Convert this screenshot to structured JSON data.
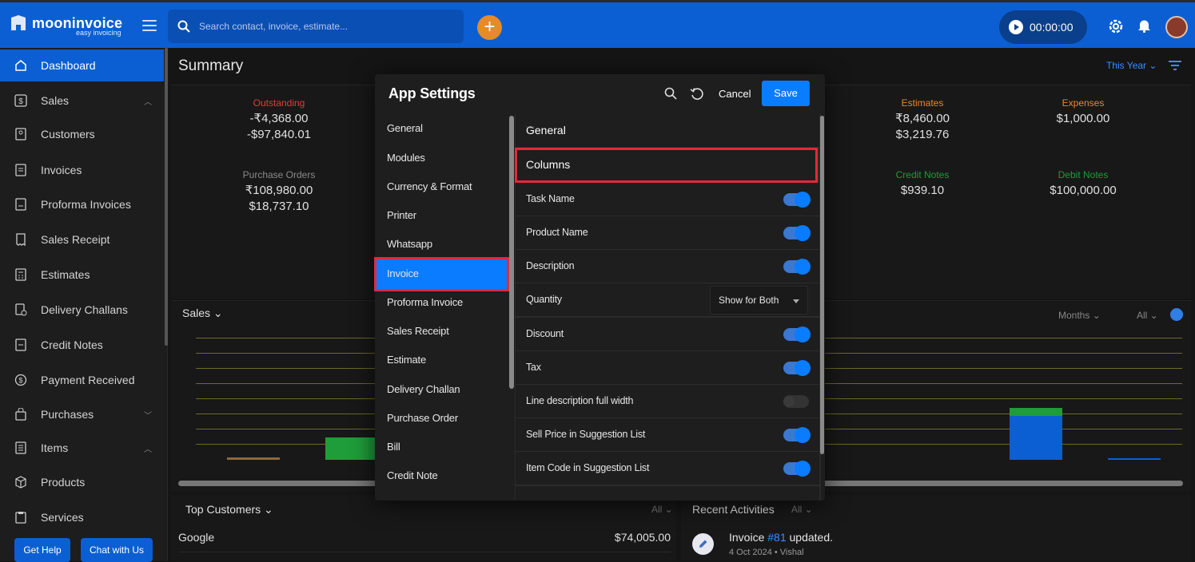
{
  "app": {
    "name": "mooninvoice",
    "tagline": "easy invoicing"
  },
  "search": {
    "placeholder": "Search contact, invoice, estimate..."
  },
  "timer": {
    "value": "00:00:00"
  },
  "sidebar": {
    "items": [
      {
        "label": "Dashboard",
        "icon": "home-icon",
        "active": true
      },
      {
        "label": "Sales",
        "icon": "dollar-icon",
        "chevron": "up"
      },
      {
        "label": "Customers",
        "icon": "contacts-icon"
      },
      {
        "label": "Invoices",
        "icon": "document-icon"
      },
      {
        "label": "Proforma Invoices",
        "icon": "document-icon"
      },
      {
        "label": "Sales Receipt",
        "icon": "receipt-icon"
      },
      {
        "label": "Estimates",
        "icon": "calculator-icon"
      },
      {
        "label": "Delivery Challans",
        "icon": "delivery-icon"
      },
      {
        "label": "Credit Notes",
        "icon": "credit-note-icon"
      },
      {
        "label": "Payment Received",
        "icon": "payment-icon"
      },
      {
        "label": "Purchases",
        "icon": "bag-icon",
        "chevron": "down"
      },
      {
        "label": "Items",
        "icon": "list-icon",
        "chevron": "up"
      },
      {
        "label": "Products",
        "icon": "box-icon"
      },
      {
        "label": "Services",
        "icon": "clipboard-icon"
      }
    ],
    "get_help": "Get Help",
    "chat": "Chat with Us"
  },
  "summary": {
    "title": "Summary",
    "period": "This Year",
    "stats": [
      {
        "title": "Outstanding",
        "color": "#e23b3b",
        "values": [
          "-₹4,368.00",
          "-$97,840.01"
        ]
      },
      {
        "title": "Estimates",
        "color": "#e68a2a",
        "values": [
          "₹8,460.00",
          "$3,219.76"
        ]
      },
      {
        "title": "Expenses",
        "color": "#e68a2a",
        "values": [
          "$1,000.00"
        ]
      },
      {
        "title": "Purchase Orders",
        "color": "#8a8a8a",
        "values": [
          "₹108,980.00",
          "$18,737.10"
        ]
      },
      {
        "title": "Credit Notes",
        "color": "#1f9d3a",
        "values": [
          "$939.10"
        ]
      },
      {
        "title": "Debit Notes",
        "color": "#1f9d3a",
        "values": [
          "$100,000.00"
        ]
      }
    ]
  },
  "sales": {
    "title": "Sales",
    "months": "Months",
    "all": "All"
  },
  "top_customers": {
    "title": "Top Customers",
    "all": "All",
    "rows": [
      {
        "name": "Google",
        "amount": "$74,005.00"
      }
    ]
  },
  "recent_activities": {
    "title": "Recent Activities",
    "all": "All",
    "item": {
      "prefix": "Invoice ",
      "link": "#81",
      "suffix": " updated.",
      "date": "4 Oct 2024",
      "user": "Vishal"
    }
  },
  "modal": {
    "title": "App Settings",
    "cancel": "Cancel",
    "save": "Save",
    "menu": [
      "General",
      "Modules",
      "Currency & Format",
      "Printer",
      "Whatsapp",
      "Invoice",
      "Proforma Invoice",
      "Sales Receipt",
      "Estimate",
      "Delivery Challan",
      "Purchase Order",
      "Bill",
      "Credit Note"
    ],
    "selected": "Invoice",
    "sections": {
      "general": "General",
      "columns": "Columns"
    },
    "rows": [
      {
        "label": "Task Name",
        "type": "toggle",
        "on": true
      },
      {
        "label": "Product Name",
        "type": "toggle",
        "on": true
      },
      {
        "label": "Description",
        "type": "toggle",
        "on": true
      },
      {
        "label": "Quantity",
        "type": "select",
        "value": "Show for Both"
      },
      {
        "label": "Discount",
        "type": "toggle",
        "on": true
      },
      {
        "label": "Tax",
        "type": "toggle",
        "on": true
      },
      {
        "label": "Line description full width",
        "type": "toggle",
        "on": false
      },
      {
        "label": "Sell Price in Suggestion List",
        "type": "toggle",
        "on": true
      },
      {
        "label": "Item Code in Suggestion List",
        "type": "toggle",
        "on": true
      }
    ]
  }
}
